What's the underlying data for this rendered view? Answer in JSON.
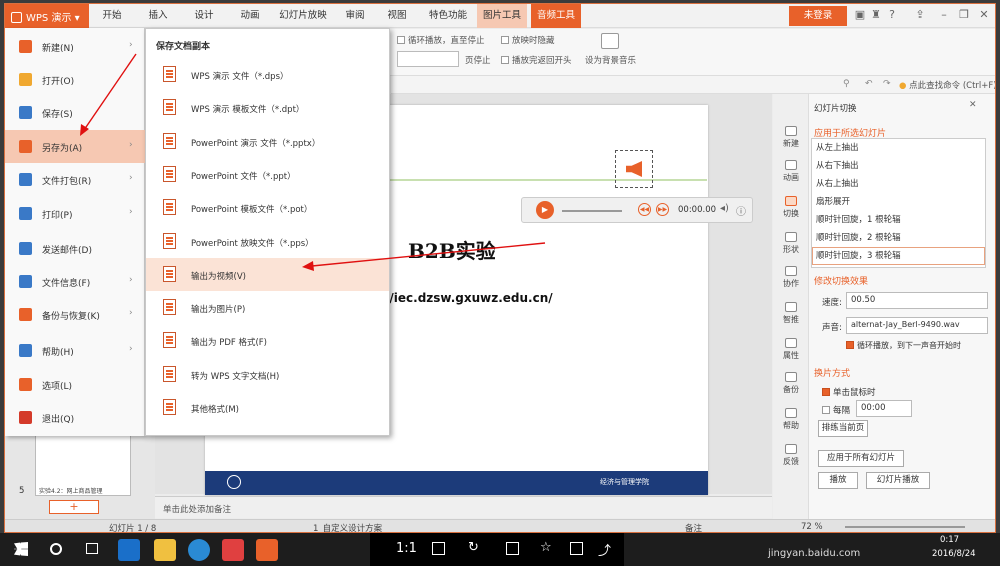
{
  "titlebar": {
    "app_label": "WPS 演示",
    "tabs": [
      "开始",
      "插入",
      "设计",
      "动画",
      "幻灯片放映",
      "审阅",
      "视图",
      "特色功能",
      "图片工具",
      "音频工具"
    ],
    "login": "未登录"
  },
  "ribbon": {
    "loop_label": "循环播放，直至停止",
    "hide_label": "放映时隐藏",
    "pages_stop": "页停止",
    "rewind_label": "播放完返回开头",
    "bg_music": "设为背景音乐"
  },
  "cmdbar": {
    "search": "点此查找命令 (Ctrl+F)"
  },
  "file_menu": {
    "items": [
      {
        "label": "新建(N)",
        "arrow": "›",
        "color": "#e8612a"
      },
      {
        "label": "打开(O)",
        "arrow": "",
        "color": "#f0a830"
      },
      {
        "label": "保存(S)",
        "arrow": "",
        "color": "#3a79c7"
      },
      {
        "label": "另存为(A)",
        "arrow": "›",
        "color": "#e8612a"
      },
      {
        "label": "文件打包(R)",
        "arrow": "›",
        "color": "#3a79c7"
      },
      {
        "label": "打印(P)",
        "arrow": "›",
        "color": "#3a79c7"
      },
      {
        "label": "发送邮件(D)",
        "arrow": "",
        "color": "#3a79c7"
      },
      {
        "label": "文件信息(F)",
        "arrow": "›",
        "color": "#3a79c7"
      },
      {
        "label": "备份与恢复(K)",
        "arrow": "›",
        "color": "#e8612a"
      },
      {
        "label": "帮助(H)",
        "arrow": "›",
        "color": "#3a79c7"
      },
      {
        "label": "选项(L)",
        "arrow": "",
        "color": "#e8612a"
      },
      {
        "label": "退出(Q)",
        "arrow": "",
        "color": "#d43a2a"
      }
    ]
  },
  "save_submenu": {
    "header": "保存文档副本",
    "items": [
      "WPS 演示 文件（*.dps）",
      "WPS 演示 模板文件（*.dpt）",
      "PowerPoint 演示 文件（*.pptx）",
      "PowerPoint 文件（*.ppt）",
      "PowerPoint 模板文件（*.pot）",
      "PowerPoint 放映文件（*.pps）",
      "输出为视频(V)",
      "输出为图片(P)",
      "输出为 PDF 格式(F)",
      "转为 WPS 文字文档(H)",
      "其他格式(M)"
    ]
  },
  "slide": {
    "title": "B2B实验",
    "url": "//iec.dzsw.gxuwz.edu.cn/",
    "footer": "经济与管理学院",
    "player_time": "00:00.00"
  },
  "left_pane": {
    "slide_num": "5",
    "thumb_caption": "实验4.2：网上商品管理"
  },
  "right_panel": {
    "header": "幻灯片切换",
    "apply_title": "应用于所选幻灯片",
    "transitions": [
      "从左上抽出",
      "从右下抽出",
      "从右上抽出",
      "扇形展开",
      "顺时针回旋，1 根轮辐",
      "顺时针回旋，2 根轮辐",
      "顺时针回旋，3 根轮辐"
    ],
    "modify_title": "修改切换效果",
    "speed_label": "速度:",
    "speed_value": "00.50",
    "sound_label": "声音:",
    "sound_value": "alternat-Jay_Berl-9490.wav",
    "loop_label": "循环播放，到下一声音开始时",
    "switch_title": "换片方式",
    "on_click": "单击鼠标时",
    "every": "每隔",
    "every_value": "00:00",
    "rehearse": "排练当前页",
    "apply_all": "应用于所有幻灯片",
    "play": "播放",
    "slideshow": "幻灯片播放"
  },
  "vtoolbar": [
    "新建",
    "动画",
    "切换",
    "形状",
    "协作",
    "智推",
    "属性",
    "备份",
    "帮助",
    "反馈"
  ],
  "notes": "单击此处添加备注",
  "status": {
    "slide": "幻灯片 1 / 8",
    "theme": "1_自定义设计方案",
    "notes": "备注",
    "zoom": "72 %"
  },
  "taskbar": {
    "ratio": "1:1",
    "time": "0:17",
    "date": "2016/8/24",
    "watermark": "jingyan.baidu.com"
  },
  "colors": {
    "accent": "#e8612a",
    "context_tab": "#f6c8b2"
  }
}
